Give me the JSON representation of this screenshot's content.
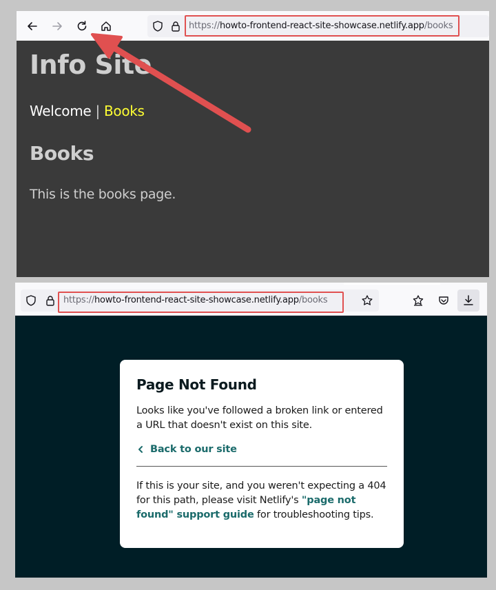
{
  "top_browser": {
    "url_prefix": "https://",
    "url_host": "howto-frontend-react-site-showcase.netlify.app",
    "url_path": "/books",
    "icons": [
      "back-arrow-icon",
      "forward-arrow-icon",
      "reload-icon",
      "home-icon",
      "shield-icon",
      "lock-icon"
    ]
  },
  "site": {
    "title": "Info Site",
    "nav_welcome": "Welcome",
    "nav_separator": "|",
    "nav_books": "Books",
    "heading": "Books",
    "paragraph": "This is the books page."
  },
  "bottom_browser": {
    "url_prefix": "https://",
    "url_host": "howto-frontend-react-site-showcase.netlify.app",
    "url_path": "/books",
    "icons": [
      "shield-icon",
      "lock-icon",
      "bookmark-star-icon",
      "extensions-icon",
      "pocket-icon",
      "download-icon"
    ]
  },
  "not_found": {
    "title": "Page Not Found",
    "message": "Looks like you've followed a broken link or entered a URL that doesn't exist on this site.",
    "back_link": "Back to our site",
    "help_before": "If this is your site, and you weren't expecting a 404 for this path, please visit Netlify's ",
    "help_link": "\"page not found\" support guide",
    "help_after": " for troubleshooting tips."
  },
  "colors": {
    "annotation_red": "#e05050",
    "site_bg": "#3a3a3a",
    "nav_link": "#ffff33",
    "netlify_bg": "#001e26",
    "netlify_link": "#1b6b6b"
  }
}
